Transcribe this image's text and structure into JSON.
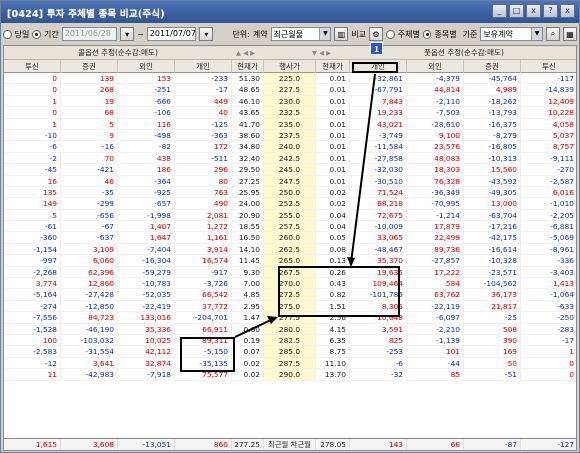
{
  "window": {
    "title": "[0424] 투자 주체별 종목 비교(주식)",
    "controls": [
      "_",
      "□",
      "x",
      "?",
      "x"
    ]
  },
  "toolbar": {
    "radio_day": "당일",
    "radio_period": "기간",
    "start_date": "2011/06/28",
    "tilde": "~",
    "end_date": "2011/07/07",
    "unit_label": "단위:",
    "unit_value": "계약",
    "month_value": "최근월물",
    "compare_label": "비교",
    "radio_by_investor": "주체별",
    "radio_by_item": "종목별",
    "basis_label": "기준",
    "basis_value": "보유계약"
  },
  "grid": {
    "group_call": "콜옵션 추정(순수감:매도)",
    "group_put": "풋옵션 추정(순수감:매도)",
    "columns": [
      "투신",
      "증권",
      "외인",
      "개인",
      "현재가",
      "행사가",
      "현재가",
      "개인",
      "외인",
      "증권",
      "투신"
    ],
    "rows": [
      [
        "0",
        "139",
        "153",
        "-233",
        "51.30",
        "225.0",
        "0.01",
        "-32,861",
        "-4,379",
        "-45,764",
        "-117"
      ],
      [
        "0",
        "268",
        "-251",
        "-17",
        "48.65",
        "227.5",
        "0.01",
        "-67,791",
        "44,814",
        "4,989",
        "-14,839"
      ],
      [
        "1",
        "19",
        "-666",
        "449",
        "46.10",
        "230.0",
        "0.01",
        "7,843",
        "-2,110",
        "-18,262",
        "12,409"
      ],
      [
        "0",
        "68",
        "-106",
        "40",
        "43.65",
        "232.5",
        "0.01",
        "19,233",
        "-7,503",
        "-13,793",
        "10,228"
      ],
      [
        "1",
        "5",
        "116",
        "-125",
        "41.70",
        "235.0",
        "0.01",
        "43,021",
        "-28,610",
        "-16,375",
        "4,058"
      ],
      [
        "-10",
        "9",
        "-498",
        "-363",
        "38.60",
        "237.5",
        "0.01",
        "-3,749",
        "9,100",
        "-8,279",
        "5,037"
      ],
      [
        "-6",
        "-16",
        "-82",
        "172",
        "34.80",
        "240.0",
        "0.01",
        "-11,584",
        "23,576",
        "-16,805",
        "8,757"
      ],
      [
        "-2",
        "70",
        "438",
        "-511",
        "32.40",
        "242.5",
        "0.01",
        "-27,858",
        "48,083",
        "-10,313",
        "-9,111"
      ],
      [
        "-45",
        "-421",
        "186",
        "296",
        "29.50",
        "245.0",
        "0.01",
        "-32,030",
        "18,303",
        "15,560",
        "-270"
      ],
      [
        "16",
        "46",
        "-364",
        "80",
        "27.25",
        "247.5",
        "0.01",
        "-30,510",
        "76,328",
        "-43,592",
        "-2,587"
      ],
      [
        "135",
        "-35",
        "-925",
        "763",
        "25.95",
        "250.0",
        "0.02",
        "71,524",
        "-36,349",
        "-49,305",
        "6,016"
      ],
      [
        "149",
        "-299",
        "-657",
        "490",
        "24.00",
        "252.5",
        "0.02",
        "68,218",
        "-70,995",
        "13,000",
        "-1,010"
      ],
      [
        "5",
        "-656",
        "-1,998",
        "2,081",
        "20.90",
        "255.0",
        "0.04",
        "72,675",
        "-1,214",
        "-63,704",
        "-2,205"
      ],
      [
        "-61",
        "-67",
        "1,407",
        "1,272",
        "18.55",
        "257.5",
        "0.04",
        "-10,009",
        "17,879",
        "-17,216",
        "-6,881"
      ],
      [
        "-360",
        "-637",
        "1,647",
        "1,161",
        "16.50",
        "260.0",
        "0.05",
        "33,065",
        "22,499",
        "-42,175",
        "-5,069"
      ],
      [
        "-1,154",
        "3,109",
        "-7,404",
        "3,914",
        "14.10",
        "262.5",
        "0.08",
        "-48,467",
        "89,736",
        "-16,614",
        "-8,961"
      ],
      [
        "-997",
        "6,060",
        "-16,304",
        "16,574",
        "11.45",
        "265.0",
        "0.13",
        "35,370",
        "-27,857",
        "-10,328",
        "-336"
      ],
      [
        "-2,268",
        "62,396",
        "-59,279",
        "-917",
        "9.30",
        "267.5",
        "0.26",
        "19,635",
        "17,222",
        "-23,571",
        "-3,403"
      ],
      [
        "3,774",
        "12,860",
        "-10,783",
        "-3,726",
        "7.00",
        "270.0",
        "0.43",
        "109,464",
        "584",
        "-104,562",
        "1,413"
      ],
      [
        "-5,164",
        "-27,428",
        "-52,035",
        "66,542",
        "4.85",
        "272.5",
        "0.82",
        "-101,785",
        "63,762",
        "36,173",
        "-1,064"
      ],
      [
        "-274",
        "-12,850",
        "-22,419",
        "37,772",
        "2.95",
        "275.0",
        "1.51",
        "8,305",
        "-22,119",
        "21,817",
        "-633"
      ],
      [
        "-7,556",
        "84,723",
        "133,016",
        "-204,701",
        "1.47",
        "277.5",
        "2.56",
        "10,648",
        "-6,097",
        "-25",
        "-250"
      ],
      [
        "-1,528",
        "-46,190",
        "35,336",
        "66,911",
        "0.60",
        "280.0",
        "4.15",
        "3,591",
        "-2,210",
        "508",
        "-283"
      ],
      [
        "100",
        "-103,032",
        "10,025",
        "89,311",
        "0.19",
        "282.5",
        "6.35",
        "825",
        "-1,139",
        "390",
        "-17"
      ],
      [
        "-2,583",
        "-31,554",
        "42,112",
        "-5,150",
        "0.07",
        "285.0",
        "8.75",
        "-253",
        "101",
        "169",
        "1"
      ],
      [
        "-12",
        "3,641",
        "32,874",
        "-35,135",
        "0.02",
        "287.5",
        "11.10",
        "-6",
        "-44",
        "50",
        "0"
      ],
      [
        "11",
        "-42,983",
        "-7,918",
        "75,577",
        "0.02",
        "290.0",
        "13.70",
        "-32",
        "85",
        "-51",
        "0"
      ]
    ],
    "footer": [
      "1,615",
      "3,608",
      "-13,051",
      "860",
      "277.25",
      "최근월 차근월",
      "278.05",
      "143",
      "66",
      "-87",
      "-127"
    ]
  },
  "annotations": {
    "badge_label": "1"
  }
}
